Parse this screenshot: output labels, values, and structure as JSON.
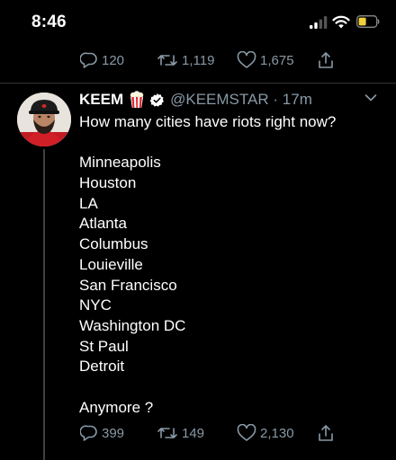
{
  "status_bar": {
    "time": "8:46"
  },
  "previous_tweet": {
    "reply_count": "120",
    "retweet_count": "1,119",
    "like_count": "1,675"
  },
  "tweet": {
    "display_name": "KEEM",
    "display_name_emoji": "popcorn",
    "handle": "@KEEMSTAR",
    "separator": "·",
    "time_ago": "17m",
    "lines": [
      "How many cities have riots right now?",
      "",
      "Minneapolis",
      "Houston",
      "LA",
      "Atlanta",
      "Columbus",
      "Louieville",
      "San Francisco",
      "NYC",
      "Washington DC",
      "St Paul",
      "Detroit",
      "",
      "Anymore ?"
    ],
    "reply_count": "399",
    "retweet_count": "149",
    "like_count": "2,130"
  },
  "colors": {
    "background": "#000000",
    "text": "#ffffff",
    "secondary": "#8899a6",
    "divider": "#2f3336",
    "battery": "#f2d13b"
  },
  "icons": [
    "signal-icon",
    "wifi-icon",
    "battery-icon",
    "reply-icon",
    "retweet-icon",
    "like-icon",
    "share-icon",
    "verified-icon",
    "chevron-down-icon",
    "popcorn-emoji"
  ]
}
